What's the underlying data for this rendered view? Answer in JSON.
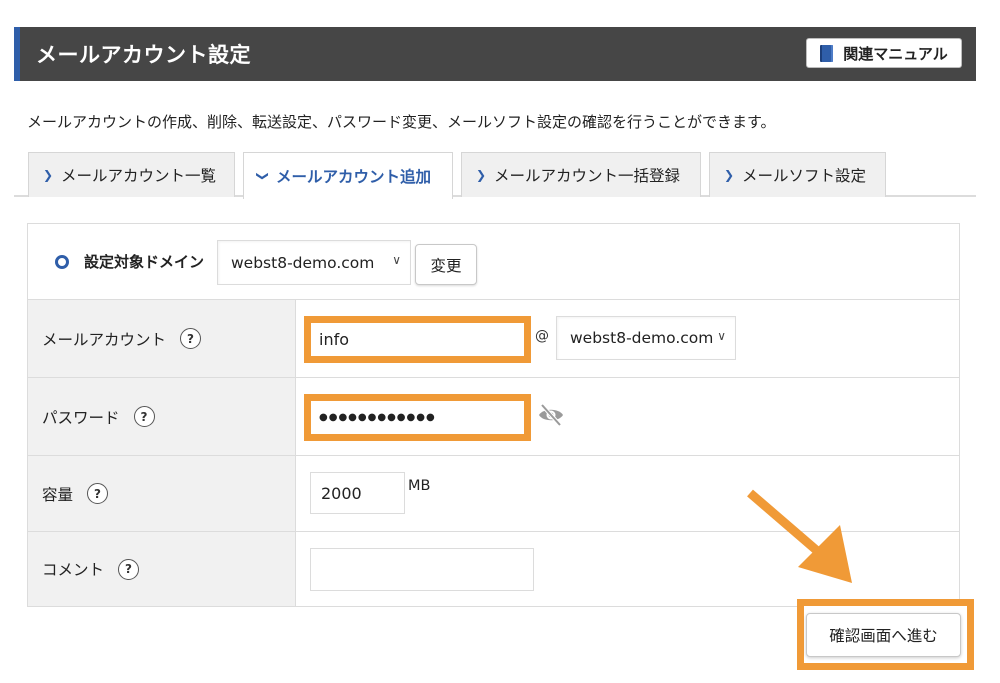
{
  "header": {
    "title": "メールアカウント設定",
    "manual_button": {
      "label": "関連マニュアル",
      "icon": "book-icon"
    }
  },
  "description": "メールアカウントの作成、削除、転送設定、パスワード変更、メールソフト設定の確認を行うことができます。",
  "tabs": [
    {
      "label": "メールアカウント一覧",
      "icon": "chevron-right-icon",
      "active": false
    },
    {
      "label": "メールアカウント追加",
      "icon": "chevron-down-icon",
      "active": true
    },
    {
      "label": "メールアカウント一括登録",
      "icon": "chevron-right-icon",
      "active": false
    },
    {
      "label": "メールソフト設定",
      "icon": "chevron-right-icon",
      "active": false
    }
  ],
  "domain_selector": {
    "label": "設定対象ドメイン",
    "selected": "webst8-demo.com",
    "change_button": "変更"
  },
  "form": {
    "account": {
      "label": "メールアカウント",
      "help": "?",
      "value": "info",
      "at_sign": "@",
      "domain_selected": "webst8-demo.com"
    },
    "password": {
      "label": "パスワード",
      "help": "?",
      "masked_value": "●●●●●●●●●●●●",
      "toggle_icon": "eye-slash-icon"
    },
    "capacity": {
      "label": "容量",
      "help": "?",
      "value": "2000",
      "unit": "MB"
    },
    "comment": {
      "label": "コメント",
      "help": "?",
      "value": ""
    }
  },
  "submit_button": "確認画面へ進む",
  "colors": {
    "header_bg": "#464646",
    "accent_blue": "#2f5ea9",
    "highlight_orange": "#f09a37",
    "label_bg": "#f1f1f1",
    "border": "#dcdcdc"
  }
}
